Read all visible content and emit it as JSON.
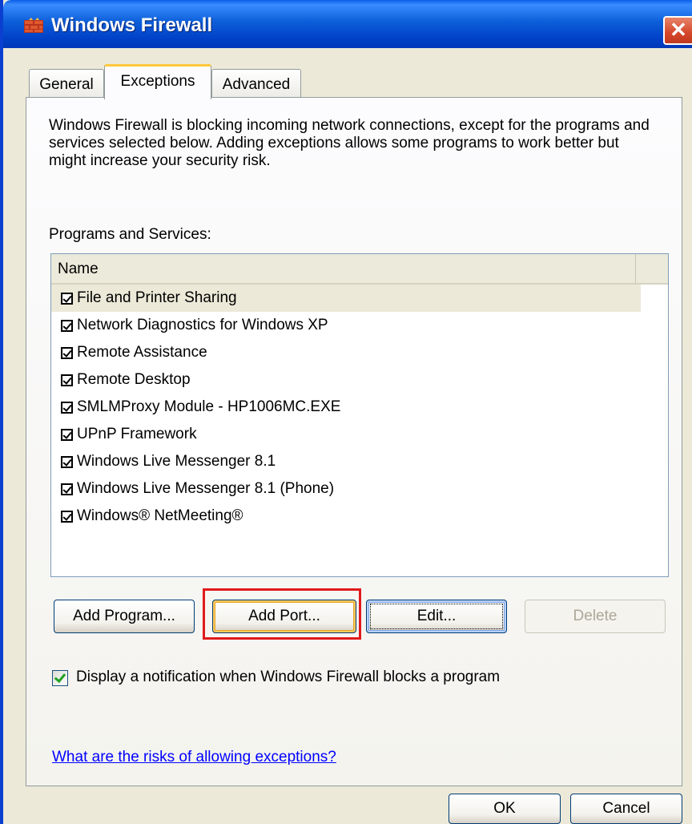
{
  "window": {
    "title": "Windows Firewall",
    "close_glyph": "✕",
    "app_icon": "firewall-brick-icon",
    "colors": {
      "title_bar": "#0a5fe8",
      "dialog_face": "#ece9d8",
      "selected_tab_accent": "#ffc83c",
      "link": "#0000ff",
      "highlight_box": "#e01a1a"
    }
  },
  "tabs": [
    {
      "label": "General"
    },
    {
      "label": "Exceptions",
      "selected": true
    },
    {
      "label": "Advanced"
    }
  ],
  "panel": {
    "intro": "Windows Firewall is blocking incoming network connections, except for the programs and services selected below. Adding exceptions allows some programs to work better but might increase your security risk.",
    "programs_label": "Programs and Services:",
    "column_header": "Name",
    "programs": [
      {
        "label": "File and Printer Sharing",
        "checked": true,
        "selected": true
      },
      {
        "label": "Network Diagnostics for Windows XP",
        "checked": true
      },
      {
        "label": "Remote Assistance",
        "checked": true
      },
      {
        "label": "Remote Desktop",
        "checked": true
      },
      {
        "label": "SMLMProxy Module - HP1006MC.EXE",
        "checked": true
      },
      {
        "label": "UPnP Framework",
        "checked": true
      },
      {
        "label": "Windows Live Messenger 8.1",
        "checked": true
      },
      {
        "label": "Windows Live Messenger 8.1 (Phone)",
        "checked": true
      },
      {
        "label": "Windows® NetMeeting®",
        "checked": true
      }
    ],
    "buttons": {
      "add_program": "Add Program...",
      "add_port": "Add Port...",
      "edit": "Edit...",
      "delete": "Delete"
    },
    "notification_label": "Display a notification when Windows Firewall blocks a program",
    "notification_checked": true,
    "help_link": "What are the risks of allowing exceptions?"
  },
  "footer": {
    "ok": "OK",
    "cancel": "Cancel"
  }
}
